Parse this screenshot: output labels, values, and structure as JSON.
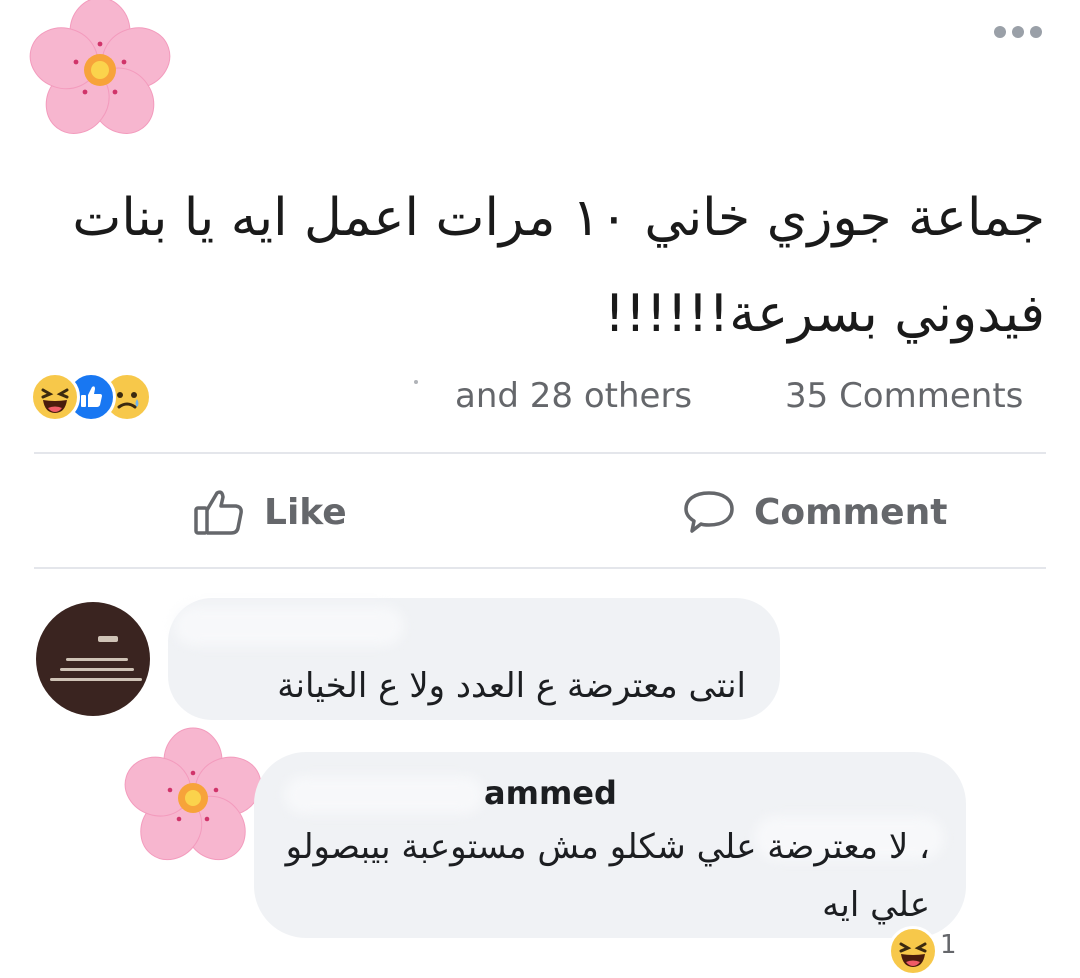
{
  "post": {
    "text": "جماعة جوزي خاني ١٠ مرات اعمل ايه يا بنات فيدوني بسرعة!!!!!!",
    "reactions": [
      "haha-icon",
      "like-icon",
      "sad-icon"
    ],
    "others_text": "and 28 others",
    "comments_count": "35 Comments",
    "colors": {
      "like_blue": "#1877f2",
      "emoji_yellow": "#f7c84a",
      "secondary_text": "#65676b"
    }
  },
  "actions": {
    "like_label": "Like",
    "comment_label": "Comment"
  },
  "comments": [
    {
      "text": "انتى معترضة ع العدد ولا ع الخيانة"
    },
    {
      "author": "ammed",
      "text": "، لا معترضة علي شكلو مش مستوعبة بيبصولو علي ايه",
      "reaction": "haha-icon",
      "reaction_count": "1"
    }
  ]
}
